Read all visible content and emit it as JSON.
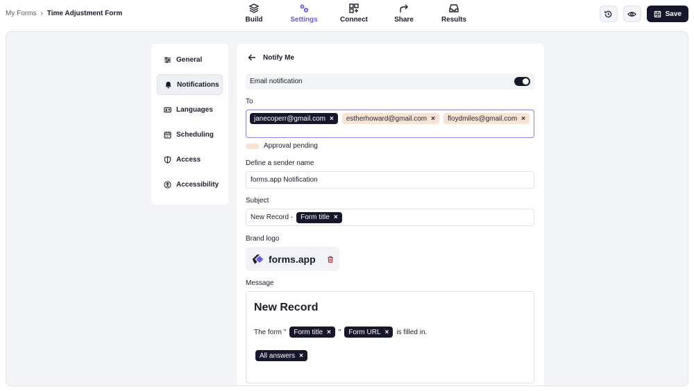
{
  "breadcrumb": {
    "root": "My Forms",
    "separator": "›",
    "current": "Time Adjustment Form"
  },
  "nav": {
    "build": "Build",
    "settings": "Settings",
    "connect": "Connect",
    "share": "Share",
    "results": "Results"
  },
  "actions": {
    "save": "Save"
  },
  "sidebar": {
    "items": [
      {
        "label": "General",
        "icon": "sliders-icon"
      },
      {
        "label": "Notifications",
        "icon": "bell-icon"
      },
      {
        "label": "Languages",
        "icon": "language-icon"
      },
      {
        "label": "Scheduling",
        "icon": "calendar-icon"
      },
      {
        "label": "Access",
        "icon": "shield-icon"
      },
      {
        "label": "Accessibility",
        "icon": "accessibility-icon"
      }
    ]
  },
  "panel": {
    "title": "Notify Me",
    "email_notification_label": "Email notification",
    "email_notification_on": true,
    "to_label": "To",
    "recipients": [
      {
        "email": "janecoperr@gmail.com",
        "status": "confirmed"
      },
      {
        "email": "estherhoward@gmail.com",
        "status": "pending"
      },
      {
        "email": "floydmiles@gmail.com",
        "status": "pending"
      }
    ],
    "legend_pending": "Approval pending",
    "sender_label": "Define a sender name",
    "sender_value": "forms.app Notification",
    "subject_label": "Subject",
    "subject_prefix": "New Record -",
    "subject_tag": "Form title",
    "brand_logo_label": "Brand logo",
    "brand_logo_text": "forms.app",
    "message_label": "Message",
    "message": {
      "heading": "New Record",
      "line_prefix": "The form \"",
      "tag_form_title": "Form title",
      "quote_mid": "\"",
      "tag_form_url": "Form URL",
      "line_suffix": "is filled in.",
      "tag_all_answers": "All answers"
    }
  },
  "colors": {
    "accent": "#6c5bd4",
    "dark": "#17172b",
    "pending": "#f6e3d3"
  }
}
